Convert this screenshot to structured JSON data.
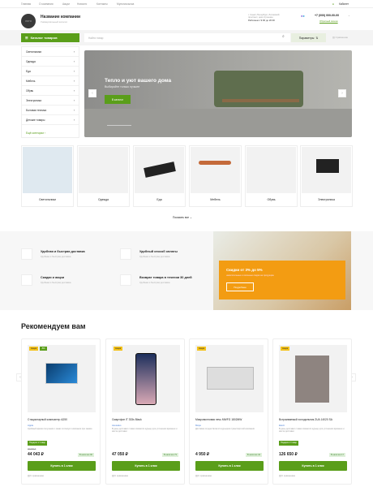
{
  "topnav": [
    "Главная",
    "О компании",
    "Акции",
    "Новости",
    "Контакты",
    "Мультиссылка"
  ],
  "account": "Кабинет",
  "company": {
    "logo": "ЛОГО",
    "name": "Название компании",
    "tagline": "Универсальный каталог"
  },
  "address": [
    "г. Санкт-Петербург, Лиговский",
    "проспект, дом строение"
  ],
  "hours": "Работаем с 9:00 до 20:00",
  "phone": "+7 (000) 000-00-00",
  "callback": "Обратный звонок",
  "catalog_label": "Каталог товаров",
  "search_placeholder": "Найти товар",
  "params_label": "Параметры",
  "compare_label": "Сравнение",
  "sidebar": [
    "Светильники",
    "Одежда",
    "Еда",
    "Мебель",
    "Обувь",
    "Электроника",
    "Бытовая техника",
    "Детские товары"
  ],
  "sidebar_all": "Ещё категории",
  "hero": {
    "title": "Тепло и уют вашего дома",
    "subtitle": "Выбирайте только лучшее",
    "button": "В каталог"
  },
  "categories": [
    "Светильники",
    "Одежда",
    "Еда",
    "Мебель",
    "Обувь",
    "Электроника"
  ],
  "show_all": "Показать все",
  "features": [
    {
      "title": "Удобная и быстрая доставка",
      "sub": "Удобная и быстрая доставка"
    },
    {
      "title": "Удобный способ оплаты",
      "sub": "Удобная и быстрая доставка"
    },
    {
      "title": "Скидки и акции",
      "sub": "Удобная и быстрая доставка"
    },
    {
      "title": "Возврат товара в течении 30 дней",
      "sub": "Удобная и быстрая доставка"
    }
  ],
  "promo": {
    "title": "Скидки от 3% до 5%",
    "sub": "накопительные и сезонные скидки на продукцию",
    "button": "Подробнее"
  },
  "recommend_title": "Рекомендуем вам",
  "products": [
    {
      "badges": [
        "Акция",
        "-5%"
      ],
      "name": "Стационарный компьютер A250",
      "brand": "Apple",
      "desc": "Удобный время получения с заказ согласует компания при заказе",
      "gift": "Подарок 2 товар",
      "old": "45 000 ₽",
      "price": "44 043 ₽",
      "stock": "В наличии 96",
      "buy": "Купить в 1 клик",
      "compare": "К сравнению"
    },
    {
      "badges": [
        "Акция"
      ],
      "name": "Смартфон iT 333s Black",
      "brand": "Asusatus",
      "desc": "В день доставки с вами свяжется курьер для уточнения времени и места доставки",
      "gift": "",
      "old": "",
      "price": "47 050 ₽",
      "stock": "В наличии 73",
      "buy": "Купить в 1 клик",
      "compare": "К сравнению"
    },
    {
      "badges": [
        "Акция"
      ],
      "name": "Микроволновая печь MWFG 1802MW",
      "brand": "Миро",
      "desc": "Доставка осуществляется курьером транспортной компании",
      "gift": "",
      "old": "",
      "price": "4 950 ₽",
      "stock": "В наличии 42",
      "buy": "Купить в 1 клик",
      "compare": "К сравнению"
    },
    {
      "badges": [
        "Акция"
      ],
      "name": "Встраиваемый холодильник ZUA 14020 SA",
      "brand": "Electr",
      "desc": "В день доставки с вами свяжется курьер для уточнения времени и места доставки",
      "gift": "Подарок 2 товар",
      "old": "",
      "price": "126 650 ₽",
      "stock": "В наличии 17",
      "buy": "Купить в 1 клик",
      "compare": "К сравнению"
    }
  ]
}
